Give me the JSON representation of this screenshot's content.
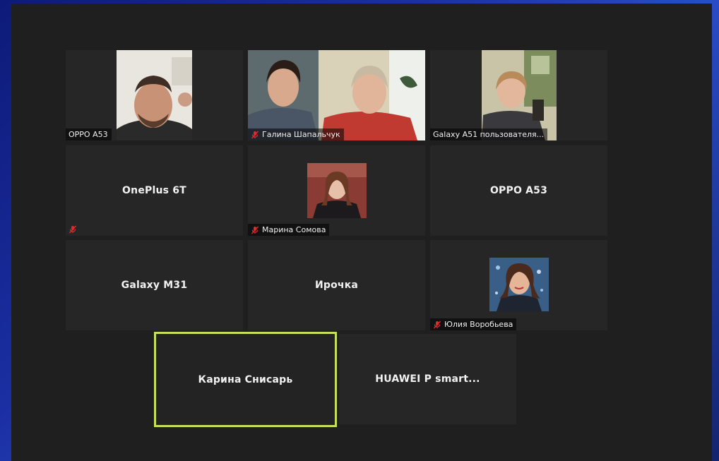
{
  "participants": [
    {
      "name": "OPPO A53",
      "video": true,
      "muted": false
    },
    {
      "name": "Галина Шапальчук",
      "video": true,
      "muted": true
    },
    {
      "name": "Galaxy A51 пользователя...",
      "video": true,
      "muted": false
    },
    {
      "name": "OnePlus 6T",
      "video": false,
      "muted": true
    },
    {
      "name": "Марина Сомова",
      "video": true,
      "muted": true
    },
    {
      "name": "OPPO A53",
      "video": false,
      "muted": false
    },
    {
      "name": "Galaxy M31",
      "video": false,
      "muted": false
    },
    {
      "name": "Ирочка",
      "video": false,
      "muted": false
    },
    {
      "name": "Юлия Воробьева",
      "video": true,
      "muted": true
    },
    {
      "name": "Карина Снисарь",
      "video": false,
      "muted": false,
      "active_speaker": true
    },
    {
      "name": "HUAWEI P smart...",
      "video": false,
      "muted": false
    }
  ],
  "colors": {
    "active_border": "#c7e05a",
    "muted_icon": "#e02b2b",
    "tile_bg": "#262626"
  },
  "icons": {
    "muted": "microphone-muted-icon"
  }
}
